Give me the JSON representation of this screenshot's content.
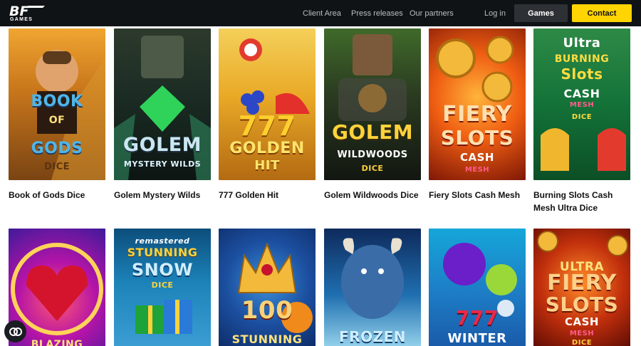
{
  "header": {
    "logo_text": "BF",
    "logo_sub": "GAMES",
    "nav": {
      "client_area": "Client Area",
      "press_releases": "Press releases",
      "our_partners": "Our partners",
      "login": "Log in",
      "games": "Games",
      "contact": "Contact"
    }
  },
  "games": [
    {
      "title": "Book of Gods Dice",
      "art_lines": [
        "BOOK",
        "OF",
        "GODS",
        "DICE"
      ]
    },
    {
      "title": "Golem Mystery Wilds",
      "art_lines": [
        "GOLEM",
        "MYSTERY WILDS"
      ]
    },
    {
      "title": "777 Golden Hit",
      "art_lines": [
        "777",
        "GOLDEN",
        "HIT"
      ]
    },
    {
      "title": "Golem Wildwoods Dice",
      "art_lines": [
        "GOLEM",
        "WILDWOODS",
        "DICE"
      ]
    },
    {
      "title": "Fiery Slots Cash Mesh",
      "art_lines": [
        "FIERY",
        "SLOTS",
        "CASH",
        "MESH"
      ]
    },
    {
      "title": "Burning Slots Cash Mesh Ultra Dice",
      "art_lines": [
        "Ultra",
        "BURNING",
        "Slots",
        "CASH",
        "MESH",
        "DICE"
      ]
    }
  ],
  "games_row2": [
    {
      "art_lines": [
        "BLAZING"
      ]
    },
    {
      "art_lines": [
        "remastered",
        "STUNNING",
        "SNOW",
        "DICE"
      ]
    },
    {
      "art_lines": [
        "100",
        "STUNNING"
      ]
    },
    {
      "art_lines": [
        "FROZEN"
      ]
    },
    {
      "art_lines": [
        "777",
        "WINTER"
      ]
    },
    {
      "art_lines": [
        "ULTRA",
        "FIERY",
        "SLOTS",
        "CASH",
        "MESH",
        "DICE"
      ]
    }
  ],
  "colors": {
    "header_bg": "#101316",
    "contact_bg": "#ffd400",
    "games_btn_bg": "#2d3136"
  },
  "icons": {
    "chat": "chat-bubble-icon",
    "logo": "bf-games-logo"
  }
}
